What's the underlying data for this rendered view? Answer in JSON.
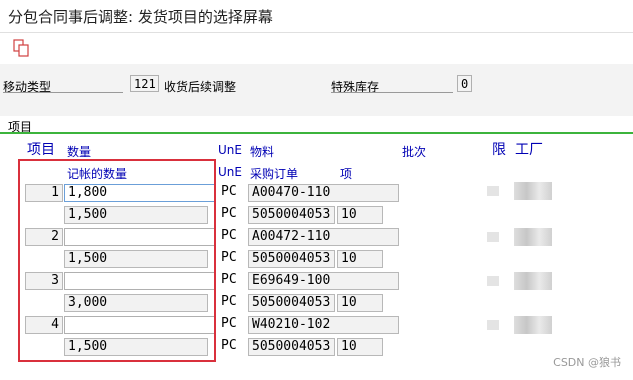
{
  "window": {
    "title": "分包合同事后调整: 发货项目的选择屏幕"
  },
  "toolbar": {
    "copy_icon": "copy-documents-icon"
  },
  "header": {
    "movement_type_label": "移动类型",
    "movement_type_value": "121",
    "movement_type_desc": "收货后续调整",
    "special_stock_label": "特殊库存",
    "special_stock_value": "0"
  },
  "items_section": {
    "title": "项目",
    "columns": {
      "item": "项目",
      "quantity": "数量",
      "posted_quantity": "记帐的数量",
      "une1": "UnE",
      "une2": "UnE",
      "material": "物料",
      "purchase_order": "采购订单",
      "po_item": "项",
      "batch": "批次",
      "limit": "限",
      "plant": "工厂"
    },
    "rows": [
      {
        "item": "1",
        "quantity": "1,800",
        "posted_quantity": "1,500",
        "unit": "PC",
        "unit2": "PC",
        "material": "A00470-110",
        "purchase_order": "5050004053",
        "po_item": "10"
      },
      {
        "item": "2",
        "quantity": "",
        "posted_quantity": "1,500",
        "unit": "PC",
        "unit2": "PC",
        "material": "A00472-110",
        "purchase_order": "5050004053",
        "po_item": "10"
      },
      {
        "item": "3",
        "quantity": "",
        "posted_quantity": "3,000",
        "unit": "PC",
        "unit2": "PC",
        "material": "E69649-100",
        "purchase_order": "5050004053",
        "po_item": "10"
      },
      {
        "item": "4",
        "quantity": "",
        "posted_quantity": "1,500",
        "unit": "PC",
        "unit2": "PC",
        "material": "W40210-102",
        "purchase_order": "5050004053",
        "po_item": "10"
      }
    ]
  },
  "watermark": "CSDN @狼书",
  "colors": {
    "accent_green": "#3cb43c",
    "header_blue": "#0000b4",
    "highlight_red": "#d9303c"
  }
}
